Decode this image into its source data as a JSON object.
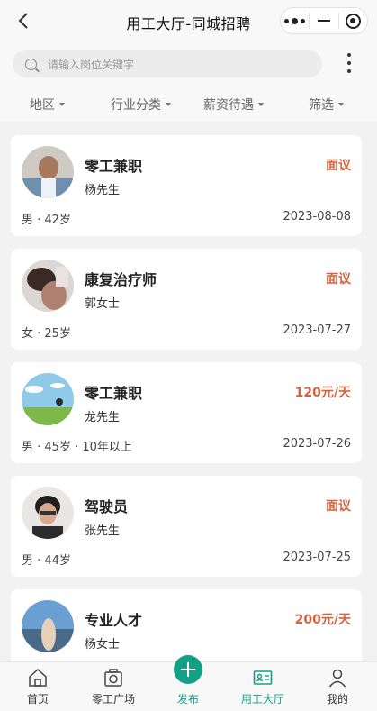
{
  "header": {
    "title": "用工大厅-同城招聘"
  },
  "search": {
    "placeholder": "请输入岗位关键字"
  },
  "filters": [
    "地区",
    "行业分类",
    "薪资待遇",
    "筛选"
  ],
  "jobs": [
    {
      "title": "零工兼职",
      "contact": "杨先生",
      "salary": "面议",
      "meta": "男 · 42岁",
      "date": "2023-08-08"
    },
    {
      "title": "康复治疗师",
      "contact": "郭女士",
      "salary": "面议",
      "meta": "女 · 25岁",
      "date": "2023-07-27"
    },
    {
      "title": "零工兼职",
      "contact": "龙先生",
      "salary": "120元/天",
      "meta": "男 · 45岁 · 10年以上",
      "date": "2023-07-26"
    },
    {
      "title": "驾驶员",
      "contact": "张先生",
      "salary": "面议",
      "meta": "男 · 44岁",
      "date": "2023-07-25"
    },
    {
      "title": "专业人才",
      "contact": "杨女士",
      "salary": "200元/天",
      "meta": "",
      "date": ""
    }
  ],
  "tabs": [
    {
      "label": "首页",
      "icon": "home-icon"
    },
    {
      "label": "零工广场",
      "icon": "camera-icon"
    },
    {
      "label": "发布",
      "icon": "plus-icon"
    },
    {
      "label": "用工大厅",
      "icon": "id-card-icon"
    },
    {
      "label": "我的",
      "icon": "user-icon"
    }
  ],
  "colors": {
    "accent": "#14a085",
    "salary": "#d7623f"
  }
}
